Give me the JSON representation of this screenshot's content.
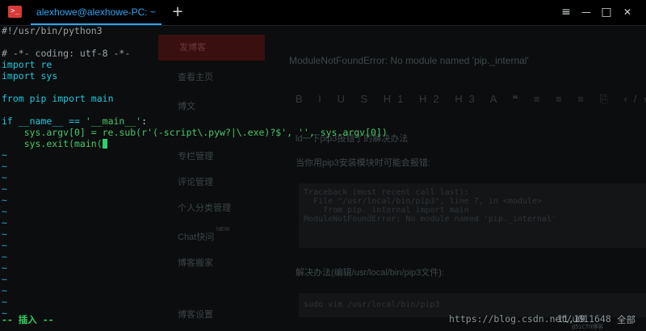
{
  "titlebar": {
    "app_icon_glyph": ">_",
    "tab_title": "alexhowe@alexhowe-PC: ~",
    "new_tab_glyph": "+",
    "icons": [
      "terminal-icon",
      "plus-icon",
      "menu-icon",
      "minimize-icon",
      "maximize-icon",
      "close-icon"
    ],
    "menu_glyph": "≡",
    "minimize_glyph": "—",
    "maximize_glyph": "□",
    "close_glyph": "✕"
  },
  "background": {
    "publish_label": "发博客",
    "sidebar_items": [
      "查看主页",
      "博文",
      "专栏管理",
      "评论管理",
      "个人分类管理",
      "Chat快问",
      "博客搬家",
      "博客设置"
    ],
    "chat_badge": "NEW",
    "error_title": "ModuleNotFoundError: No module named 'pip._internal'",
    "toolbar": "B I U S H1 H2 H3 A ❝ ≡ ≡ ≡ ⎘ ‹/› Σ ⊞ ▦",
    "section_title": "ld一下pip3报错了的解决办法",
    "intro": "当你用pip3安装模块时可能会报错:",
    "traceback_lines": [
      "Traceback (most recent call last):",
      "  File \"/usr/local/bin/pip3\", line 7, in <module>",
      "    from pip._internal import main",
      "ModuleNotFoundError: No module named 'pip._internal'"
    ],
    "solution_label": "解决办法(编辑/usr/local/bin/pip3文件):",
    "solution_cmd": "sudo vim /usr/local/bin/pip3"
  },
  "terminal": {
    "shebang": "#!/usr/bin/python3",
    "coding_comment": "# -*- coding: utf-8 -*-",
    "import_kw": "import",
    "module_re": " re",
    "module_sys": " sys",
    "from_kw": "from",
    "pip_name": " pip ",
    "import_main": " main",
    "if_kw": "if",
    "if_cond": " __name__ == ",
    "main_str": "'__main__'",
    "colon": ":",
    "argv_prefix": "    sys.argv[0] = re.sub(",
    "regex_str": "r'(-script\\.pyw?|\\.exe)?$'",
    "empty_str": "''",
    "argv_suffix": ", sys.argv[0])",
    "comma_sep": ", ",
    "exit_line": "    sys.exit(main(",
    "tilde": "~",
    "tilde_count": 15,
    "mode": "-- 插入 --",
    "cursor_pos": "11,19",
    "cursor_view": "全部",
    "watermark": "https://blog.csdn.net/u011648",
    "watermark_small": "@51CTO博客"
  }
}
